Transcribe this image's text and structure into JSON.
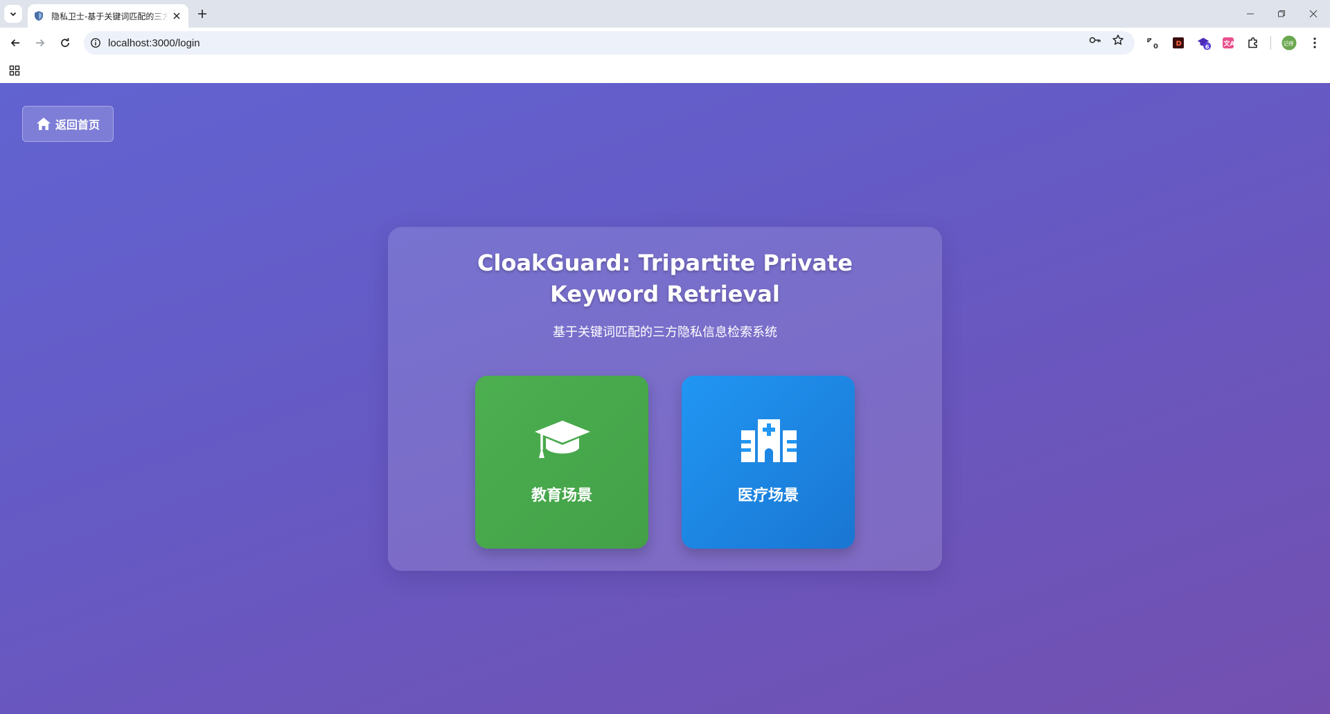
{
  "browser": {
    "tab": {
      "title": "隐私卫士-基于关键词匹配的三方隐私信息检索系统",
      "favicon": "shield-favicon-icon"
    },
    "address_bar": {
      "url": "localhost:3000/login"
    },
    "extensions": [
      {
        "name": "tab-counter-extension-icon",
        "badge": "0"
      },
      {
        "name": "red-square-extension-icon",
        "badge": ""
      },
      {
        "name": "purple-hat-extension-icon",
        "badge": "6"
      },
      {
        "name": "translate-extension-icon",
        "badge": ""
      },
      {
        "name": "puzzle-extensions-icon",
        "badge": ""
      }
    ],
    "profile_avatar_text": "记得"
  },
  "page": {
    "home_button": {
      "label": "返回首页",
      "icon": "home-icon"
    },
    "title": "CloakGuard: Tripartite Private Keyword Retrieval",
    "subtitle": "基于关键词匹配的三方隐私信息检索系统",
    "scenes": [
      {
        "label": "教育场景",
        "icon": "graduation-cap-icon",
        "color": "#4caf50"
      },
      {
        "label": "医疗场景",
        "icon": "hospital-icon",
        "color": "#2196f3"
      }
    ]
  },
  "colors": {
    "background_start": "#6163d1",
    "background_end": "#7350b0",
    "education_card": "#4caf50",
    "medical_card": "#2196f3"
  }
}
